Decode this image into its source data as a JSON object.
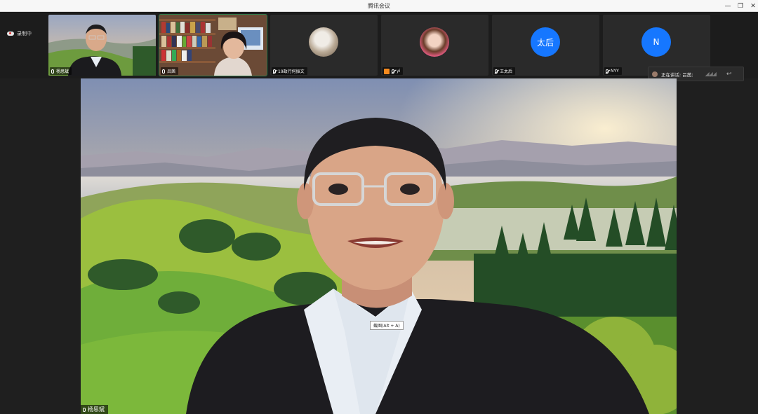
{
  "window": {
    "title": "腾讯会议"
  },
  "recording": {
    "label": "录制中"
  },
  "participants": [
    {
      "name": "杨思斌",
      "kind": "video",
      "mic": "on"
    },
    {
      "name": "吕茜",
      "kind": "video",
      "mic": "on",
      "active": true
    },
    {
      "name": "19政行何振文",
      "kind": "avatar-photo",
      "mic": "muted"
    },
    {
      "name": "yi",
      "kind": "avatar-photo",
      "mic": "muted"
    },
    {
      "name": "王太后",
      "kind": "avatar-text",
      "avatar_text": "太后",
      "mic": "muted"
    },
    {
      "name": "NYY",
      "kind": "avatar-text",
      "avatar_text": "N",
      "mic": "muted"
    }
  ],
  "speaking": {
    "label": "正在讲话: 吕茜;"
  },
  "main": {
    "speaker_name": "杨思斌"
  },
  "tooltip": {
    "text": "截图(Alt + A)"
  },
  "colors": {
    "avatar_blue": "#1677ff",
    "active_border": "#2f7d4a",
    "recording_dot": "#e03535"
  }
}
